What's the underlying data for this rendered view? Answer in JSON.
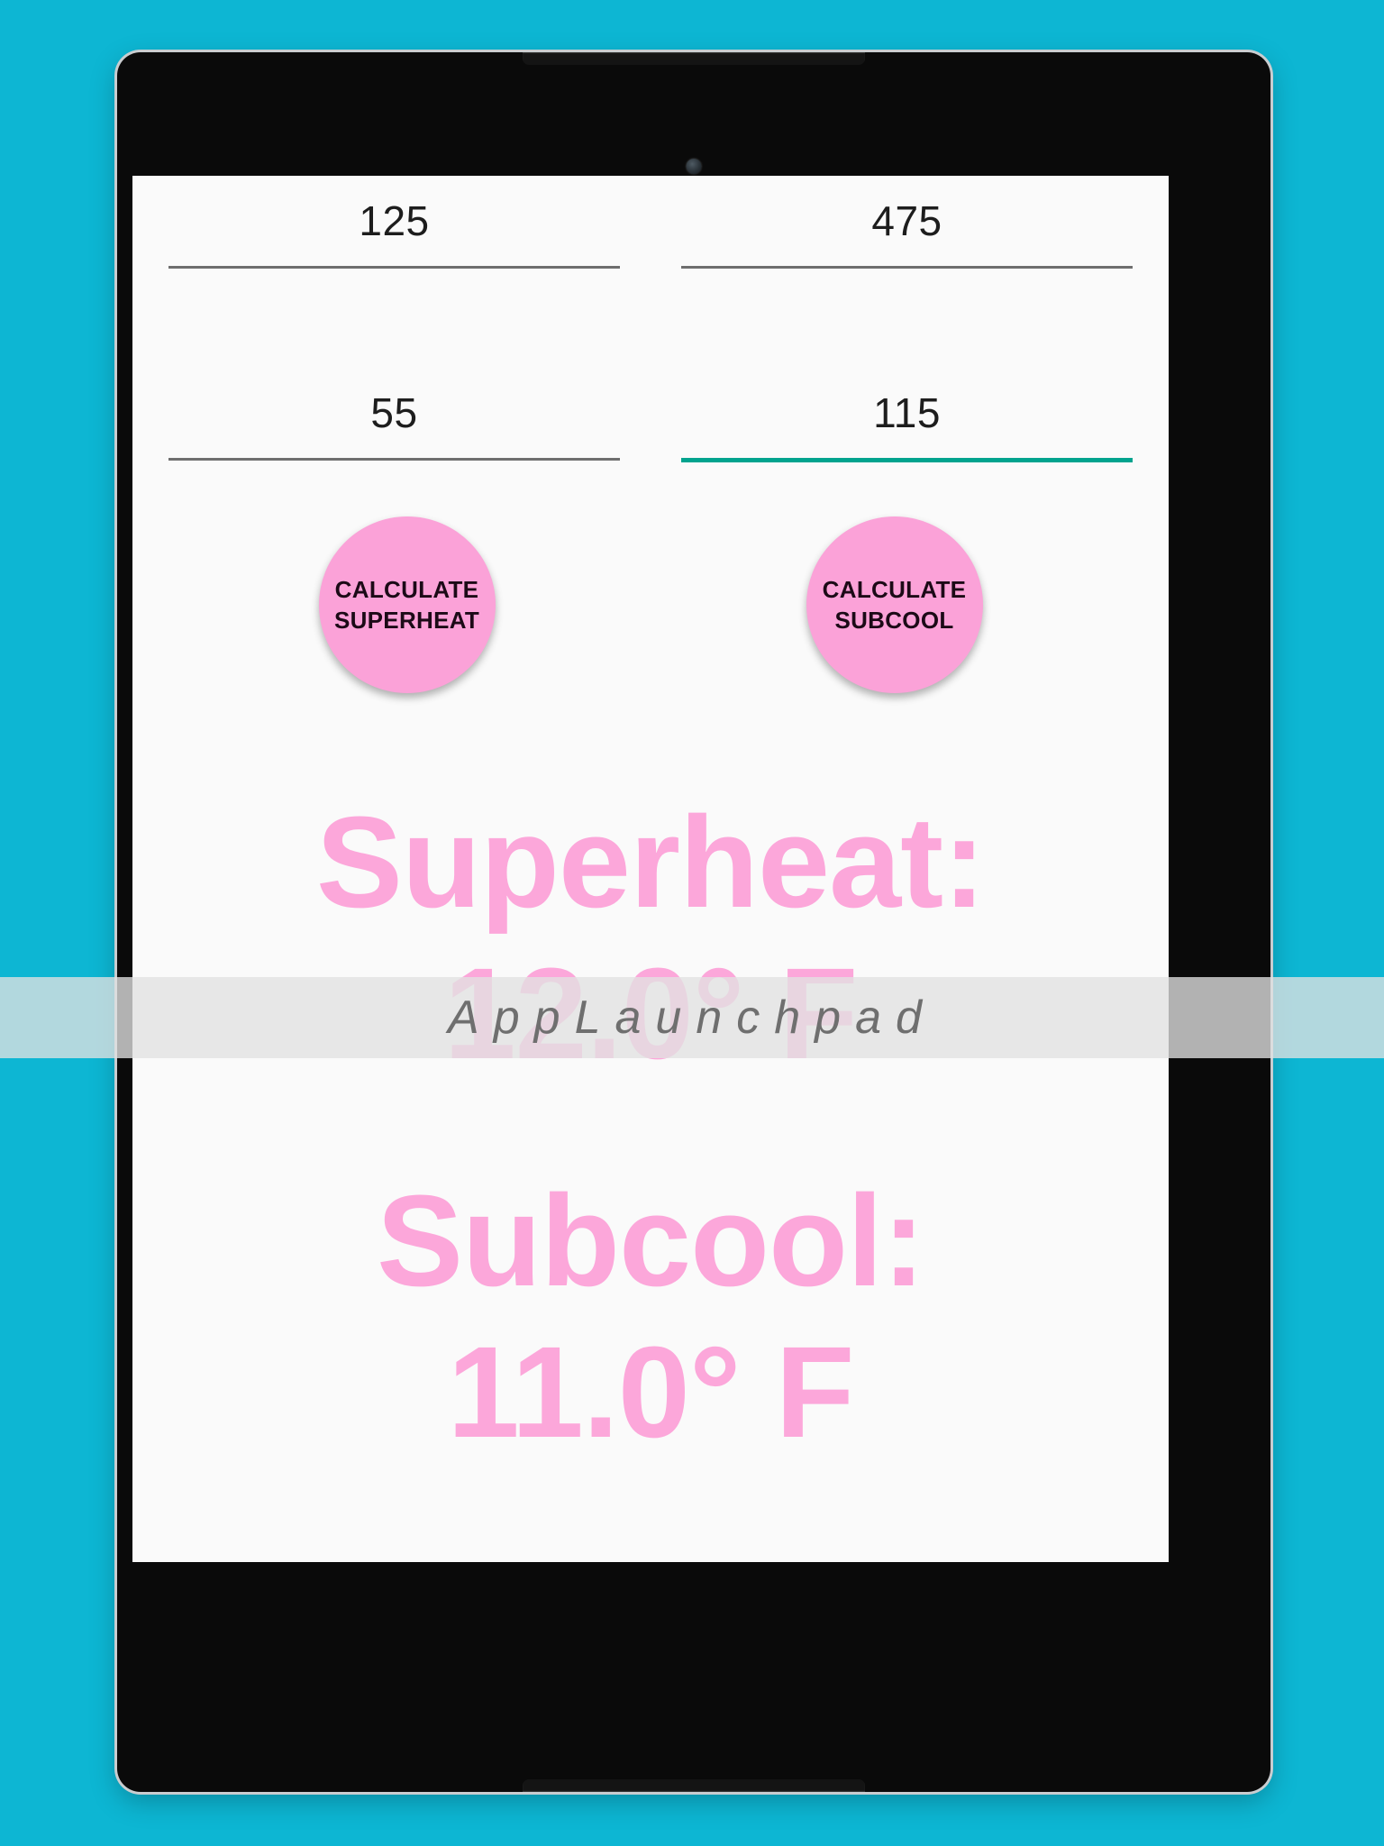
{
  "background": {
    "color": "#0db6d3"
  },
  "device": {
    "name": "tablet-device-frame",
    "bezel_color": "#0a0a0a",
    "screen_background": "#fafafa"
  },
  "app": {
    "accent_pink": "#fba2d8",
    "result_pink": "#fca7da",
    "focus_teal": "#00a38e",
    "inputs": [
      {
        "name": "input-top-left",
        "value": "125",
        "focused": false
      },
      {
        "name": "input-top-right",
        "value": "475",
        "focused": false
      },
      {
        "name": "input-bottom-left",
        "value": "55",
        "focused": false
      },
      {
        "name": "input-bottom-right",
        "value": "115",
        "focused": true
      }
    ],
    "buttons": {
      "superheat": {
        "line1": "CALCULATE",
        "line2": "SUPERHEAT"
      },
      "subcool": {
        "line1": "CALCULATE",
        "line2": "SUBCOOL"
      }
    },
    "results": {
      "superheat_label": "Superheat:",
      "superheat_value": "12.0° F",
      "subcool_label": "Subcool:",
      "subcool_value": "11.0° F"
    }
  },
  "watermark": {
    "text": "AppLaunchpad"
  }
}
